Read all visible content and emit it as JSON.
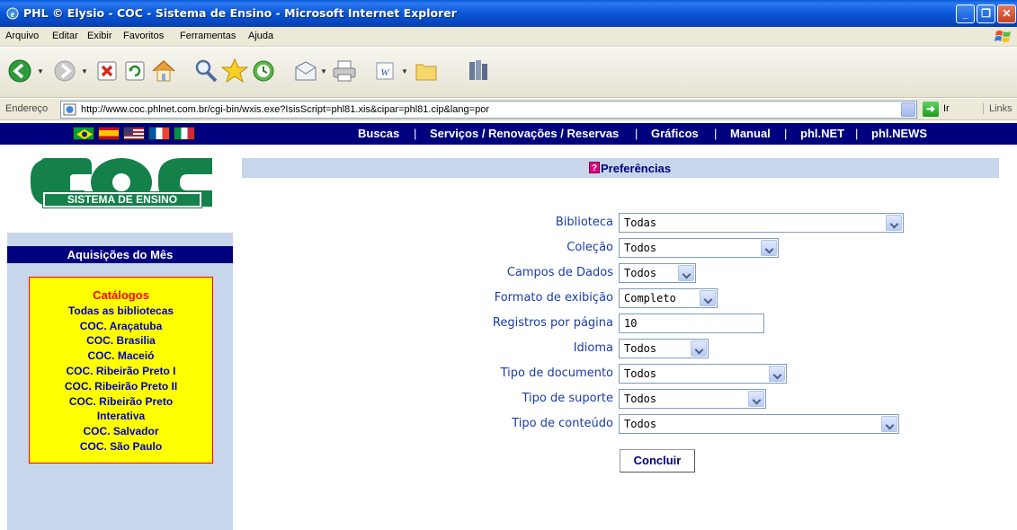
{
  "window": {
    "title": "PHL © Elysio - COC - Sistema de Ensino - Microsoft Internet Explorer"
  },
  "menu": [
    "Arquivo",
    "Editar",
    "Exibir",
    "Favoritos",
    "Ferramentas",
    "Ajuda"
  ],
  "toolbar": {
    "icons": [
      "back-icon",
      "forward-icon",
      "stop-icon",
      "refresh-icon",
      "home-icon",
      "search-icon",
      "favorites-icon",
      "history-icon",
      "mail-icon",
      "print-icon",
      "word-icon",
      "folder-icon",
      "research-icon"
    ]
  },
  "address": {
    "label": "Endereço",
    "url": "http://www.coc.phlnet.com.br/cgi-bin/wxis.exe?IsisScript=phl81.xis&cipar=phl81.cip&lang=por",
    "go_label": "Ir",
    "links_label": "Links"
  },
  "nav": {
    "items": [
      "Buscas",
      "Serviços / Renovações / Reservas",
      "Gráficos",
      "Manual",
      "phl.NET",
      "phl.NEWS"
    ],
    "separator": "|"
  },
  "logo": {
    "subtitle": "SISTEMA DE ENSINO"
  },
  "sidebar": {
    "title": "Aquisições do Mês",
    "catalog_heading": "Catálogos",
    "catalog_items": [
      "Todas as bibliotecas",
      "COC. Araçatuba",
      "COC. Brasilia",
      "COC. Maceió",
      "COC. Ribeirão Preto I",
      "COC. Ribeirão Preto II",
      "COC. Ribeirão Preto",
      "Interativa",
      "COC. Salvador",
      "COC. São Paulo"
    ]
  },
  "preferences": {
    "title": "Preferências",
    "fields": [
      {
        "label": "Biblioteca",
        "value": "Todas"
      },
      {
        "label": "Coleção",
        "value": "Todos"
      },
      {
        "label": "Campos de Dados",
        "value": "Todos"
      },
      {
        "label": "Formato de exibição",
        "value": "Completo"
      },
      {
        "label": "Registros por página",
        "value": "10"
      },
      {
        "label": "Idioma",
        "value": "Todos"
      },
      {
        "label": "Tipo de documento",
        "value": "Todos"
      },
      {
        "label": "Tipo de suporte",
        "value": "Todos"
      },
      {
        "label": "Tipo de conteúdo",
        "value": "Todos"
      }
    ],
    "submit_label": "Concluir"
  },
  "colors": {
    "nav_bg": "#00007f",
    "panel_bg": "#c7d6ea",
    "catalog_bg": "#ffff00",
    "catalog_heading": "#ff0000",
    "logo_green": "#14804a"
  }
}
